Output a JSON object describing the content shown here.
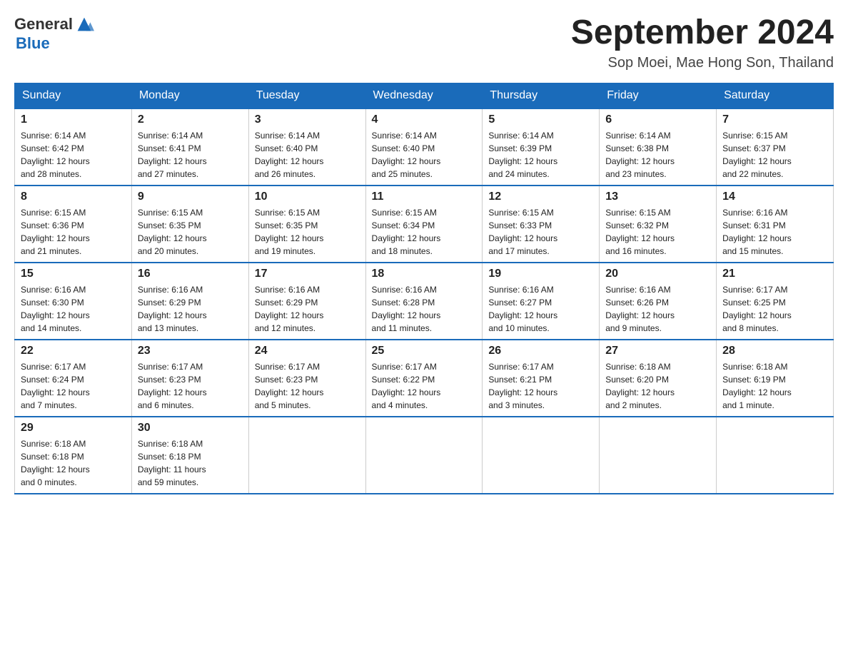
{
  "header": {
    "logo_general": "General",
    "logo_blue": "Blue",
    "month_title": "September 2024",
    "location": "Sop Moei, Mae Hong Son, Thailand"
  },
  "weekdays": [
    "Sunday",
    "Monday",
    "Tuesday",
    "Wednesday",
    "Thursday",
    "Friday",
    "Saturday"
  ],
  "weeks": [
    [
      {
        "day": "1",
        "sunrise": "6:14 AM",
        "sunset": "6:42 PM",
        "daylight": "12 hours and 28 minutes."
      },
      {
        "day": "2",
        "sunrise": "6:14 AM",
        "sunset": "6:41 PM",
        "daylight": "12 hours and 27 minutes."
      },
      {
        "day": "3",
        "sunrise": "6:14 AM",
        "sunset": "6:40 PM",
        "daylight": "12 hours and 26 minutes."
      },
      {
        "day": "4",
        "sunrise": "6:14 AM",
        "sunset": "6:40 PM",
        "daylight": "12 hours and 25 minutes."
      },
      {
        "day": "5",
        "sunrise": "6:14 AM",
        "sunset": "6:39 PM",
        "daylight": "12 hours and 24 minutes."
      },
      {
        "day": "6",
        "sunrise": "6:14 AM",
        "sunset": "6:38 PM",
        "daylight": "12 hours and 23 minutes."
      },
      {
        "day": "7",
        "sunrise": "6:15 AM",
        "sunset": "6:37 PM",
        "daylight": "12 hours and 22 minutes."
      }
    ],
    [
      {
        "day": "8",
        "sunrise": "6:15 AM",
        "sunset": "6:36 PM",
        "daylight": "12 hours and 21 minutes."
      },
      {
        "day": "9",
        "sunrise": "6:15 AM",
        "sunset": "6:35 PM",
        "daylight": "12 hours and 20 minutes."
      },
      {
        "day": "10",
        "sunrise": "6:15 AM",
        "sunset": "6:35 PM",
        "daylight": "12 hours and 19 minutes."
      },
      {
        "day": "11",
        "sunrise": "6:15 AM",
        "sunset": "6:34 PM",
        "daylight": "12 hours and 18 minutes."
      },
      {
        "day": "12",
        "sunrise": "6:15 AM",
        "sunset": "6:33 PM",
        "daylight": "12 hours and 17 minutes."
      },
      {
        "day": "13",
        "sunrise": "6:15 AM",
        "sunset": "6:32 PM",
        "daylight": "12 hours and 16 minutes."
      },
      {
        "day": "14",
        "sunrise": "6:16 AM",
        "sunset": "6:31 PM",
        "daylight": "12 hours and 15 minutes."
      }
    ],
    [
      {
        "day": "15",
        "sunrise": "6:16 AM",
        "sunset": "6:30 PM",
        "daylight": "12 hours and 14 minutes."
      },
      {
        "day": "16",
        "sunrise": "6:16 AM",
        "sunset": "6:29 PM",
        "daylight": "12 hours and 13 minutes."
      },
      {
        "day": "17",
        "sunrise": "6:16 AM",
        "sunset": "6:29 PM",
        "daylight": "12 hours and 12 minutes."
      },
      {
        "day": "18",
        "sunrise": "6:16 AM",
        "sunset": "6:28 PM",
        "daylight": "12 hours and 11 minutes."
      },
      {
        "day": "19",
        "sunrise": "6:16 AM",
        "sunset": "6:27 PM",
        "daylight": "12 hours and 10 minutes."
      },
      {
        "day": "20",
        "sunrise": "6:16 AM",
        "sunset": "6:26 PM",
        "daylight": "12 hours and 9 minutes."
      },
      {
        "day": "21",
        "sunrise": "6:17 AM",
        "sunset": "6:25 PM",
        "daylight": "12 hours and 8 minutes."
      }
    ],
    [
      {
        "day": "22",
        "sunrise": "6:17 AM",
        "sunset": "6:24 PM",
        "daylight": "12 hours and 7 minutes."
      },
      {
        "day": "23",
        "sunrise": "6:17 AM",
        "sunset": "6:23 PM",
        "daylight": "12 hours and 6 minutes."
      },
      {
        "day": "24",
        "sunrise": "6:17 AM",
        "sunset": "6:23 PM",
        "daylight": "12 hours and 5 minutes."
      },
      {
        "day": "25",
        "sunrise": "6:17 AM",
        "sunset": "6:22 PM",
        "daylight": "12 hours and 4 minutes."
      },
      {
        "day": "26",
        "sunrise": "6:17 AM",
        "sunset": "6:21 PM",
        "daylight": "12 hours and 3 minutes."
      },
      {
        "day": "27",
        "sunrise": "6:18 AM",
        "sunset": "6:20 PM",
        "daylight": "12 hours and 2 minutes."
      },
      {
        "day": "28",
        "sunrise": "6:18 AM",
        "sunset": "6:19 PM",
        "daylight": "12 hours and 1 minute."
      }
    ],
    [
      {
        "day": "29",
        "sunrise": "6:18 AM",
        "sunset": "6:18 PM",
        "daylight": "12 hours and 0 minutes."
      },
      {
        "day": "30",
        "sunrise": "6:18 AM",
        "sunset": "6:18 PM",
        "daylight": "11 hours and 59 minutes."
      },
      null,
      null,
      null,
      null,
      null
    ]
  ],
  "labels": {
    "sunrise": "Sunrise:",
    "sunset": "Sunset:",
    "daylight": "Daylight:"
  }
}
